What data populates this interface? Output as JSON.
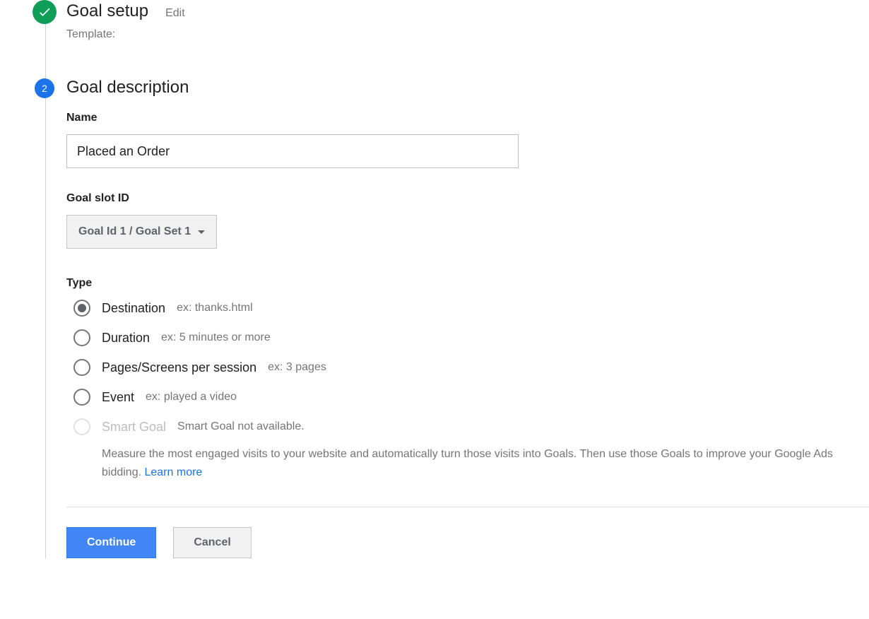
{
  "step1": {
    "title": "Goal setup",
    "edit_label": "Edit",
    "template_label": "Template:"
  },
  "step2": {
    "number": "2",
    "title": "Goal description",
    "name_label": "Name",
    "name_value": "Placed an Order",
    "slot_label": "Goal slot ID",
    "slot_selected": "Goal Id 1 / Goal Set 1",
    "type_label": "Type",
    "types": {
      "destination": {
        "label": "Destination",
        "example": "ex: thanks.html",
        "selected": true
      },
      "duration": {
        "label": "Duration",
        "example": "ex: 5 minutes or more",
        "selected": false
      },
      "pages": {
        "label": "Pages/Screens per session",
        "example": "ex: 3 pages",
        "selected": false
      },
      "event": {
        "label": "Event",
        "example": "ex: played a video",
        "selected": false
      },
      "smart": {
        "label": "Smart Goal",
        "example": "Smart Goal not available.",
        "disabled": true
      }
    },
    "smart_description": "Measure the most engaged visits to your website and automatically turn those visits into Goals. Then use those Goals to improve your Google Ads bidding. ",
    "learn_more": "Learn more"
  },
  "buttons": {
    "continue": "Continue",
    "cancel": "Cancel"
  }
}
